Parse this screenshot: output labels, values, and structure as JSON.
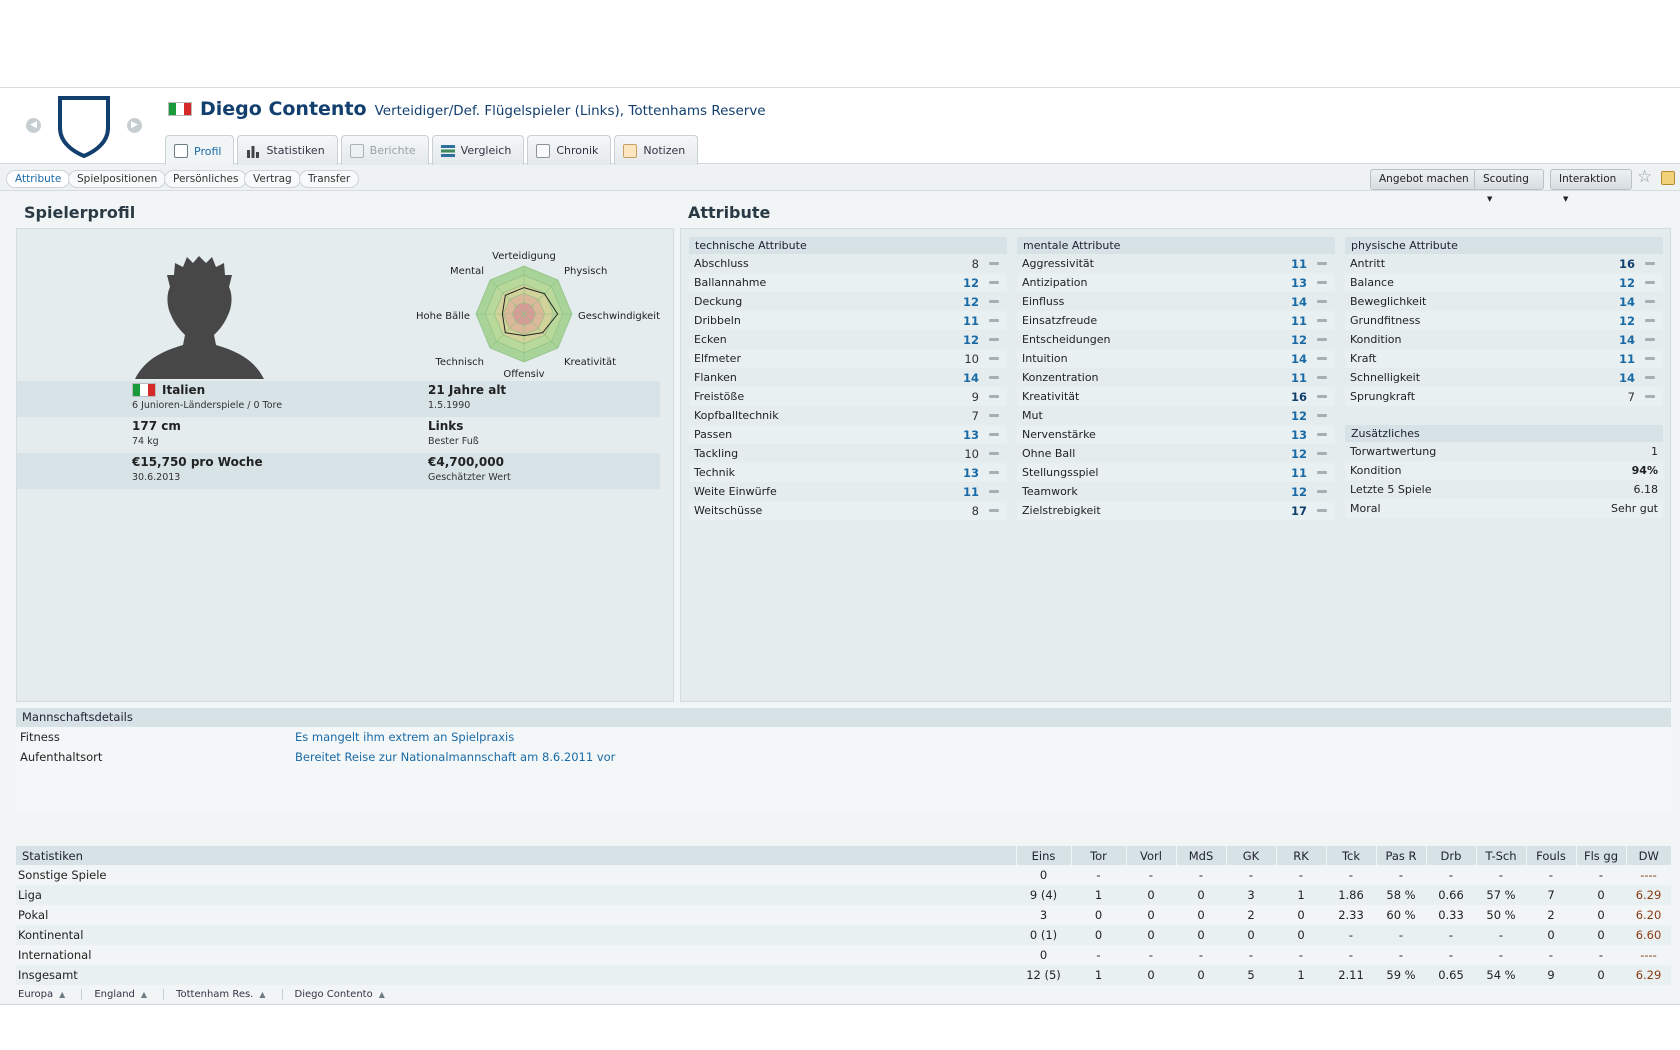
{
  "player": {
    "name": "Diego Contento",
    "subtitle": "Verteidiger/Def. Flügelspieler (Links), Tottenhams Reserve",
    "flag_colors": [
      "#1a9a3a",
      "#ffffff",
      "#d52a2a"
    ]
  },
  "tabs": [
    {
      "label": "Profil",
      "icon": "profile-icon"
    },
    {
      "label": "Statistiken",
      "icon": "bar-chart-icon"
    },
    {
      "label": "Berichte",
      "icon": "report-icon"
    },
    {
      "label": "Vergleich",
      "icon": "compare-icon"
    },
    {
      "label": "Chronik",
      "icon": "history-icon"
    },
    {
      "label": "Notizen",
      "icon": "notes-icon"
    }
  ],
  "subtabs": [
    "Attribute",
    "Spielpositionen",
    "Persönliches",
    "Vertrag",
    "Transfer"
  ],
  "actions": {
    "offer": "Angebot machen",
    "scouting": "Scouting",
    "interaction": "Interaktion"
  },
  "profile": {
    "title": "Spielerprofil",
    "radar_labels": [
      "Verteidigung",
      "Physisch",
      "Geschwindigkeit",
      "Kreativität",
      "Offensiv",
      "Technisch",
      "Hohe Bälle",
      "Mental"
    ],
    "radar_values": [
      0.55,
      0.6,
      0.7,
      0.55,
      0.45,
      0.55,
      0.45,
      0.55
    ],
    "nationality": "Italien",
    "international": "6 Junioren-Länderspiele / 0 Tore",
    "age": "21 Jahre alt",
    "birth": "1.5.1990",
    "height": "177 cm",
    "weight": "74 kg",
    "foot": "Links",
    "foot_label": "Bester Fuß",
    "wage": "€15,750 pro Woche",
    "contract_end": "30.6.2013",
    "value": "€4,700,000",
    "value_label": "Geschätzter Wert"
  },
  "attributes": {
    "title": "Attribute",
    "technical": {
      "title": "technische Attribute",
      "items": [
        {
          "name": "Abschluss",
          "value": "8"
        },
        {
          "name": "Ballannahme",
          "value": "12"
        },
        {
          "name": "Deckung",
          "value": "12"
        },
        {
          "name": "Dribbeln",
          "value": "11"
        },
        {
          "name": "Ecken",
          "value": "12"
        },
        {
          "name": "Elfmeter",
          "value": "10"
        },
        {
          "name": "Flanken",
          "value": "14"
        },
        {
          "name": "Freistöße",
          "value": "9"
        },
        {
          "name": "Kopfballtechnik",
          "value": "7"
        },
        {
          "name": "Passen",
          "value": "13"
        },
        {
          "name": "Tackling",
          "value": "10"
        },
        {
          "name": "Technik",
          "value": "13"
        },
        {
          "name": "Weite Einwürfe",
          "value": "11"
        },
        {
          "name": "Weitschüsse",
          "value": "8"
        }
      ]
    },
    "mental": {
      "title": "mentale Attribute",
      "items": [
        {
          "name": "Aggressivität",
          "value": "11"
        },
        {
          "name": "Antizipation",
          "value": "13"
        },
        {
          "name": "Einfluss",
          "value": "14"
        },
        {
          "name": "Einsatzfreude",
          "value": "11"
        },
        {
          "name": "Entscheidungen",
          "value": "12"
        },
        {
          "name": "Intuition",
          "value": "14"
        },
        {
          "name": "Konzentration",
          "value": "11"
        },
        {
          "name": "Kreativität",
          "value": "16"
        },
        {
          "name": "Mut",
          "value": "12"
        },
        {
          "name": "Nervenstärke",
          "value": "13"
        },
        {
          "name": "Ohne Ball",
          "value": "12"
        },
        {
          "name": "Stellungsspiel",
          "value": "11"
        },
        {
          "name": "Teamwork",
          "value": "12"
        },
        {
          "name": "Zielstrebigkeit",
          "value": "17"
        }
      ]
    },
    "physical": {
      "title": "physische Attribute",
      "items": [
        {
          "name": "Antritt",
          "value": "16"
        },
        {
          "name": "Balance",
          "value": "12"
        },
        {
          "name": "Beweglichkeit",
          "value": "14"
        },
        {
          "name": "Grundfitness",
          "value": "12"
        },
        {
          "name": "Kondition",
          "value": "14"
        },
        {
          "name": "Kraft",
          "value": "11"
        },
        {
          "name": "Schnelligkeit",
          "value": "14"
        },
        {
          "name": "Sprungkraft",
          "value": "7"
        }
      ]
    },
    "extra": {
      "title": "Zusätzliches",
      "items": [
        {
          "name": "Torwartwertung",
          "value": "1"
        },
        {
          "name": "Kondition",
          "value": "94%"
        },
        {
          "name": "Letzte 5 Spiele",
          "value": "6.18"
        },
        {
          "name": "Moral",
          "value": "Sehr gut"
        }
      ]
    }
  },
  "team_details": {
    "title": "Mannschaftsdetails",
    "rows": [
      {
        "key": "Fitness",
        "value": "Es mangelt ihm extrem an Spielpraxis"
      },
      {
        "key": "Aufenthaltsort",
        "value": "Bereitet Reise zur Nationalmannschaft am 8.6.2011 vor"
      }
    ]
  },
  "stats": {
    "title": "Statistiken",
    "columns": [
      "Eins",
      "Tor",
      "Vorl",
      "MdS",
      "GK",
      "RK",
      "Tck",
      "Pas R",
      "Drb",
      "T-Sch",
      "Fouls",
      "Fls gg",
      "DW"
    ],
    "rows": [
      {
        "label": "Sonstige Spiele",
        "values": [
          "0",
          "-",
          "-",
          "-",
          "-",
          "-",
          "-",
          "-",
          "-",
          "-",
          "-",
          "-",
          "----"
        ]
      },
      {
        "label": "Liga",
        "values": [
          "9 (4)",
          "1",
          "0",
          "0",
          "3",
          "1",
          "1.86",
          "58 %",
          "0.66",
          "57 %",
          "7",
          "0",
          "6.29"
        ]
      },
      {
        "label": "Pokal",
        "values": [
          "3",
          "0",
          "0",
          "0",
          "2",
          "0",
          "2.33",
          "60 %",
          "0.33",
          "50 %",
          "2",
          "0",
          "6.20"
        ]
      },
      {
        "label": "Kontinental",
        "values": [
          "0 (1)",
          "0",
          "0",
          "0",
          "0",
          "0",
          "-",
          "-",
          "-",
          "-",
          "0",
          "0",
          "6.60"
        ]
      },
      {
        "label": "International",
        "values": [
          "0",
          "-",
          "-",
          "-",
          "-",
          "-",
          "-",
          "-",
          "-",
          "-",
          "-",
          "-",
          "----"
        ]
      },
      {
        "label": "Insgesamt",
        "values": [
          "12 (5)",
          "1",
          "0",
          "0",
          "5",
          "1",
          "2.11",
          "59 %",
          "0.65",
          "54 %",
          "9",
          "0",
          "6.29"
        ]
      }
    ]
  },
  "breadcrumb": [
    "Europa",
    "England",
    "Tottenham Res.",
    "Diego Contento"
  ],
  "colors": {
    "accent": "#1a6aa5",
    "title": "#123f6e",
    "dw": "#8a3b13"
  }
}
